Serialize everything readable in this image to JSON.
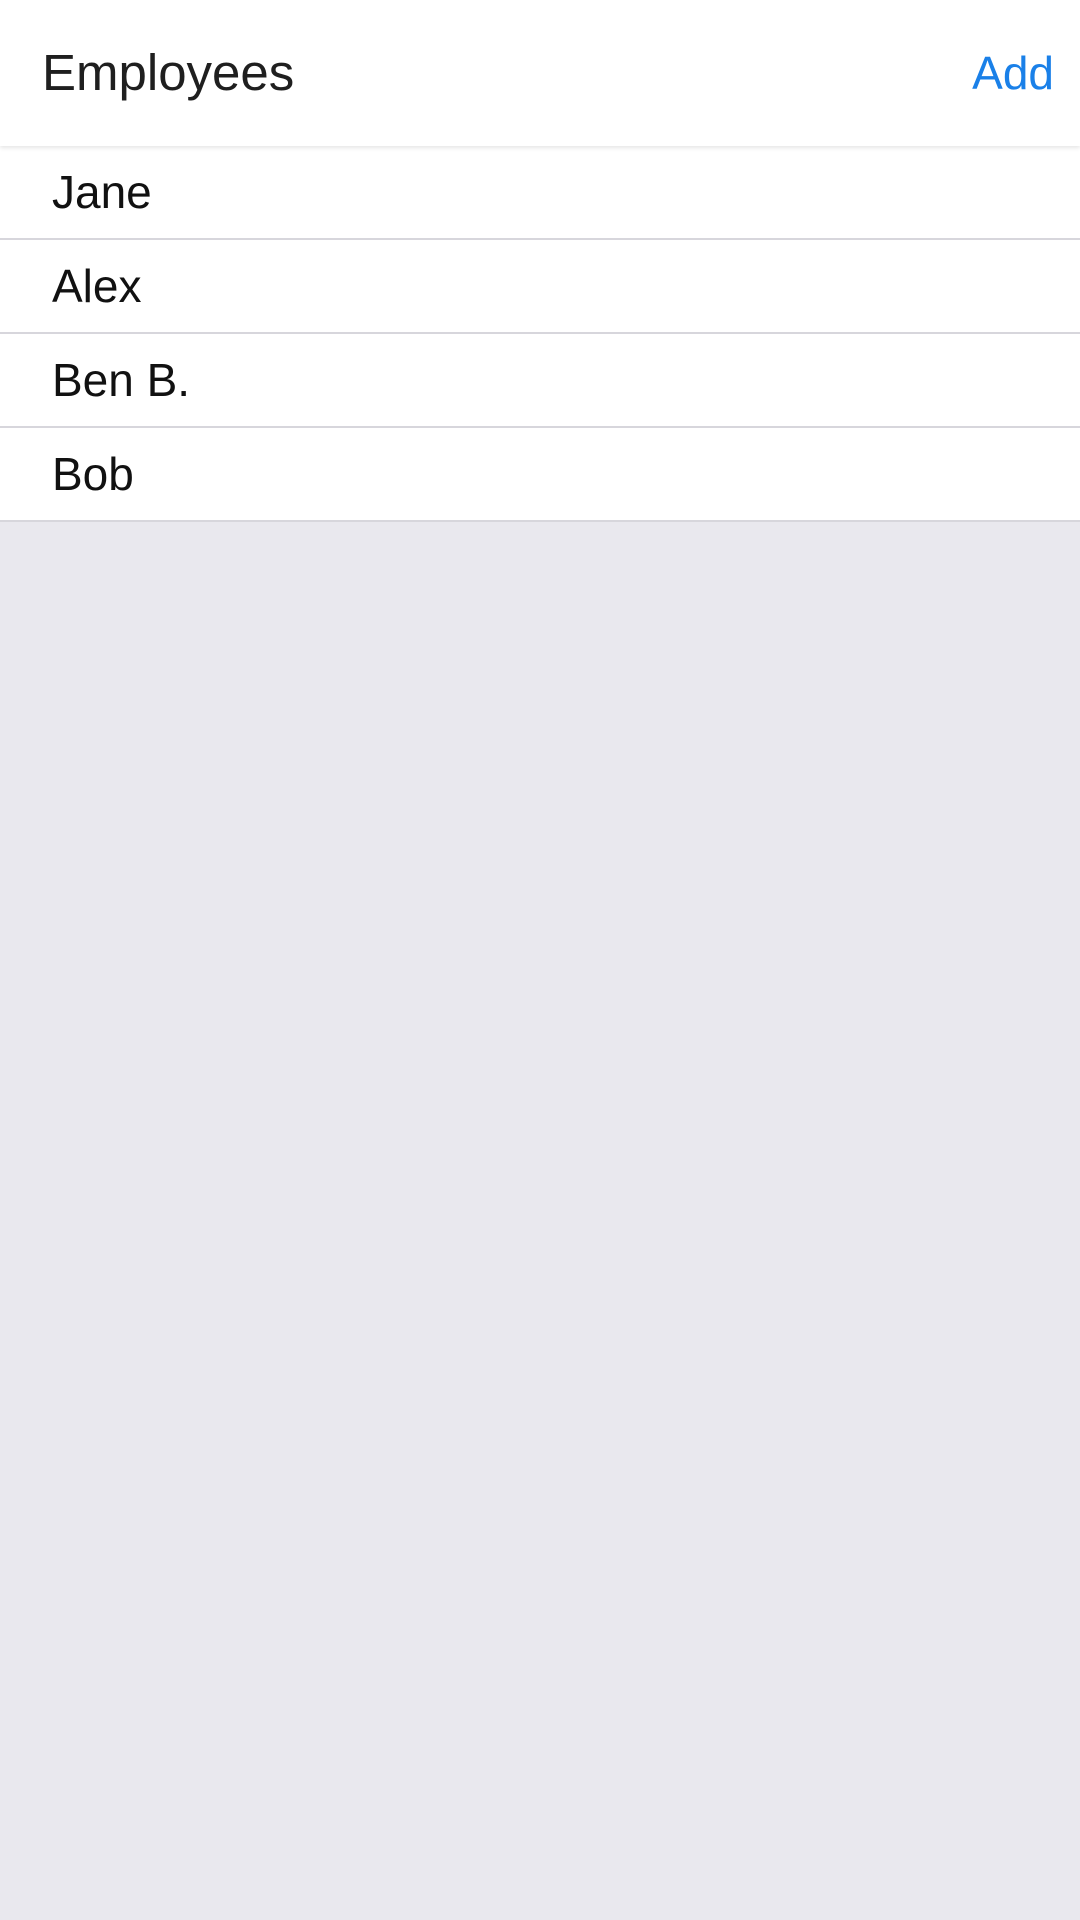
{
  "header": {
    "title": "Employees",
    "add_label": "Add"
  },
  "employees": [
    {
      "name": "Jane"
    },
    {
      "name": "Alex"
    },
    {
      "name": "Ben B."
    },
    {
      "name": "Bob"
    }
  ],
  "colors": {
    "accent": "#1a80e8",
    "background": "#e9e8ee",
    "surface": "#ffffff",
    "divider": "#d7d6dc"
  }
}
